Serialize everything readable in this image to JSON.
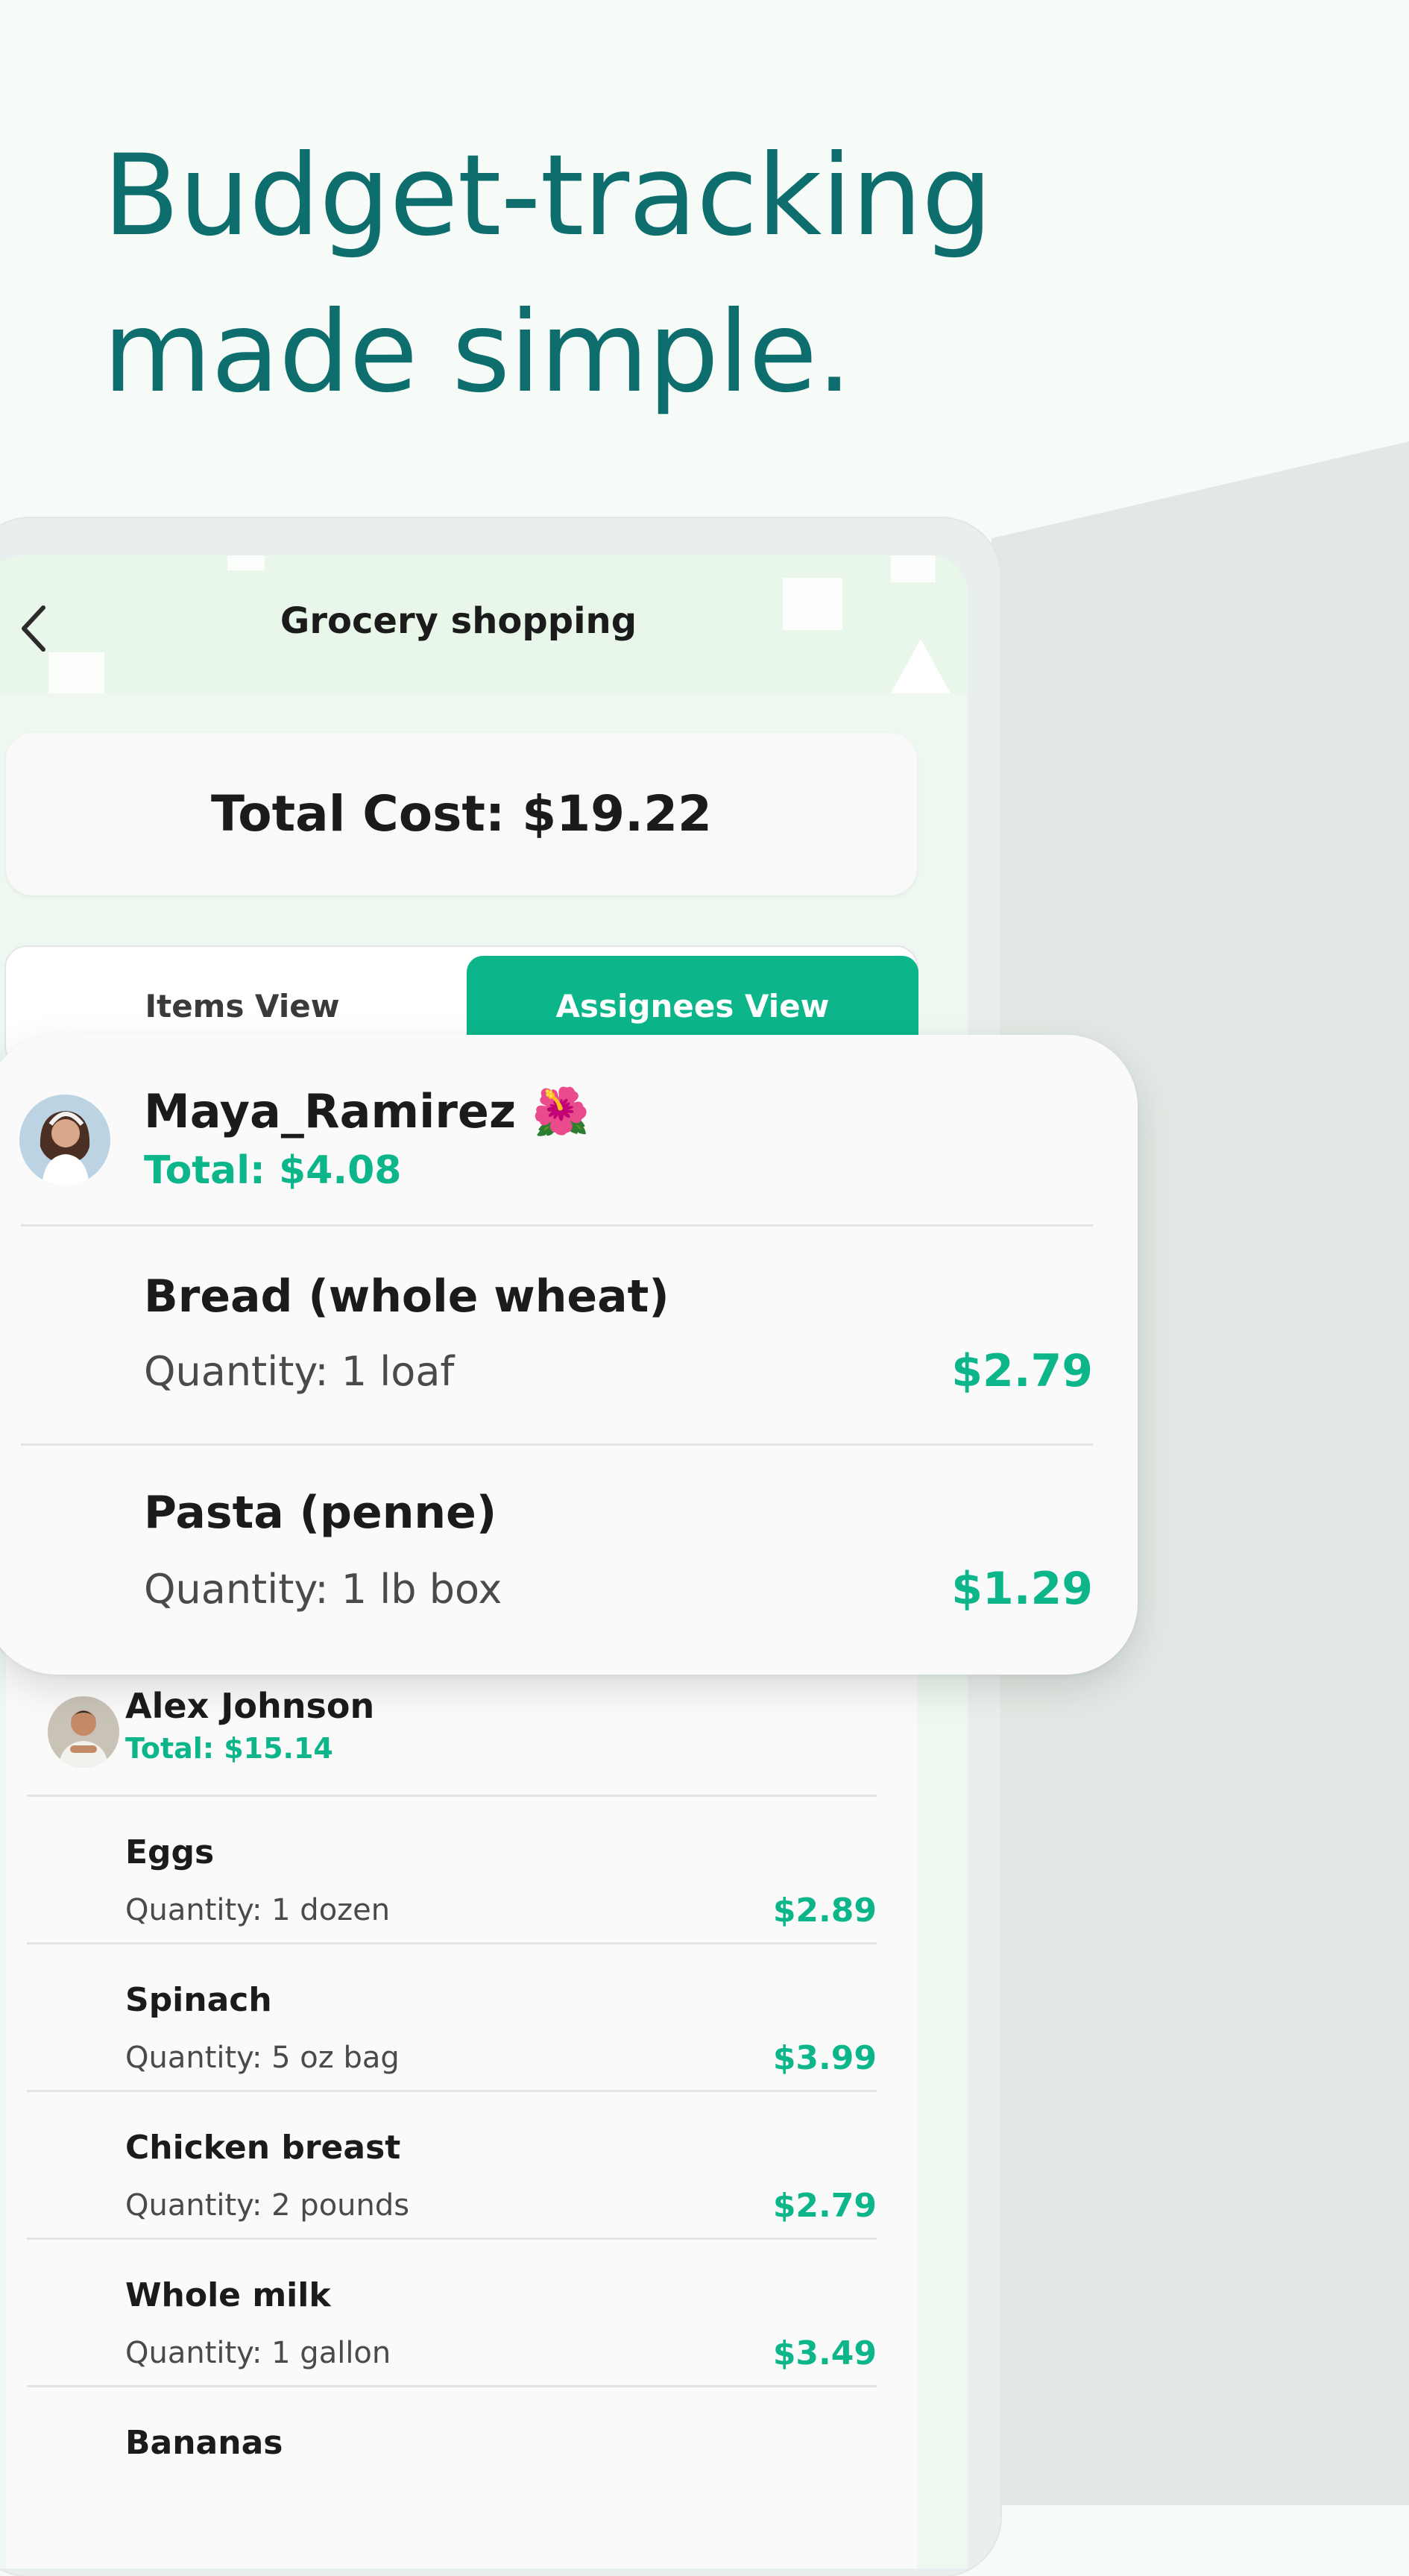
{
  "headline": {
    "line1": "Budget-tracking",
    "line2": "made simple."
  },
  "colors": {
    "headline": "#0e6e6e",
    "accent": "#0cb68a",
    "background": "#f6fbf8"
  },
  "screen": {
    "title": "Grocery shopping",
    "back_icon": "chevron-left-icon",
    "total_cost": "Total Cost: $19.22",
    "tabs": {
      "items": "Items View",
      "assignees": "Assignees View",
      "selected": "Assignees View"
    }
  },
  "featured": {
    "name": "Maya_Ramirez 🌺",
    "total": "Total: $4.08",
    "avatar_icon": "user-avatar-icon",
    "items": [
      {
        "name": "Bread (whole wheat)",
        "quantity": "Quantity: 1 loaf",
        "price": "$2.79"
      },
      {
        "name": "Pasta (penne)",
        "quantity": "Quantity: 1 lb box",
        "price": "$1.29"
      }
    ]
  },
  "assignee": {
    "name": "Alex Johnson",
    "total": "Total: $15.14",
    "avatar_icon": "user-avatar-icon",
    "items": [
      {
        "name": "Eggs",
        "quantity": "Quantity: 1 dozen",
        "price": "$2.89"
      },
      {
        "name": "Spinach",
        "quantity": "Quantity: 5 oz bag",
        "price": "$3.99"
      },
      {
        "name": "Chicken breast",
        "quantity": "Quantity: 2 pounds",
        "price": "$2.79"
      },
      {
        "name": "Whole milk",
        "quantity": "Quantity: 1 gallon",
        "price": "$3.49"
      },
      {
        "name": "Bananas",
        "quantity": "",
        "price": ""
      }
    ]
  }
}
